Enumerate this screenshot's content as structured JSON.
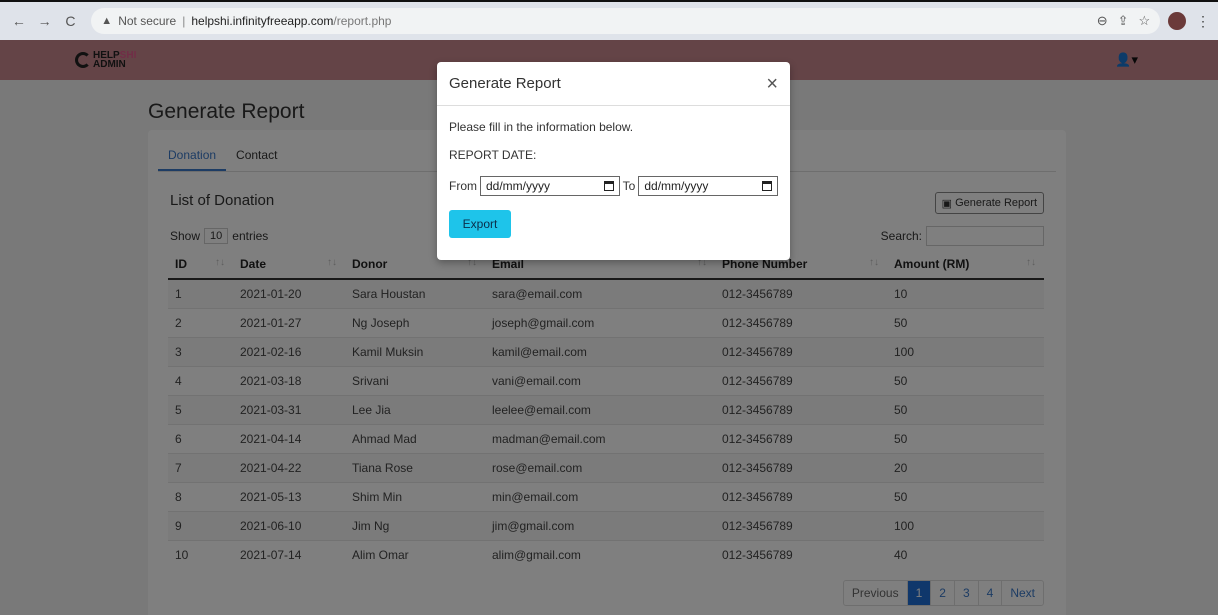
{
  "browser": {
    "security": "Not secure",
    "host": "helpshi.infinityfreeapp.com",
    "path": "/report.php"
  },
  "app": {
    "logo_top": "HELP",
    "logo_pink": "SHI",
    "logo_bottom": "ADMIN"
  },
  "page": {
    "title": "Generate Report",
    "tabs": [
      "Donation",
      "Contact"
    ],
    "list_title": "List of Donation",
    "generate_button": "Generate Report",
    "show_label": "Show",
    "entries_value": "10",
    "entries_label": "entries",
    "search_label": "Search:",
    "columns": [
      "ID",
      "Date",
      "Donor",
      "Email",
      "Phone Number",
      "Amount (RM)"
    ],
    "rows": [
      [
        "1",
        "2021-01-20",
        "Sara Houstan",
        "sara@email.com",
        "012-3456789",
        "10"
      ],
      [
        "2",
        "2021-01-27",
        "Ng Joseph",
        "joseph@gmail.com",
        "012-3456789",
        "50"
      ],
      [
        "3",
        "2021-02-16",
        "Kamil Muksin",
        "kamil@email.com",
        "012-3456789",
        "100"
      ],
      [
        "4",
        "2021-03-18",
        "Srivani",
        "vani@email.com",
        "012-3456789",
        "50"
      ],
      [
        "5",
        "2021-03-31",
        "Lee Jia",
        "leelee@email.com",
        "012-3456789",
        "50"
      ],
      [
        "6",
        "2021-04-14",
        "Ahmad Mad",
        "madman@email.com",
        "012-3456789",
        "50"
      ],
      [
        "7",
        "2021-04-22",
        "Tiana Rose",
        "rose@email.com",
        "012-3456789",
        "20"
      ],
      [
        "8",
        "2021-05-13",
        "Shim Min",
        "min@email.com",
        "012-3456789",
        "50"
      ],
      [
        "9",
        "2021-06-10",
        "Jim Ng",
        "jim@gmail.com",
        "012-3456789",
        "100"
      ],
      [
        "10",
        "2021-07-14",
        "Alim Omar",
        "alim@gmail.com",
        "012-3456789",
        "40"
      ]
    ],
    "pagination": [
      "Previous",
      "1",
      "2",
      "3",
      "4",
      "Next"
    ]
  },
  "modal": {
    "title": "Generate Report",
    "close": "×",
    "instruction": "Please fill in the information below.",
    "date_label": "REPORT DATE:",
    "from_label": "From",
    "from_placeholder": "dd/mm/yyyy",
    "to_label": "To",
    "to_placeholder": "dd/mm/yyyy",
    "export_label": "Export"
  },
  "colors": {
    "navbar": "#c9898f",
    "accent": "#3a78c8",
    "export": "#1ec4ea"
  }
}
